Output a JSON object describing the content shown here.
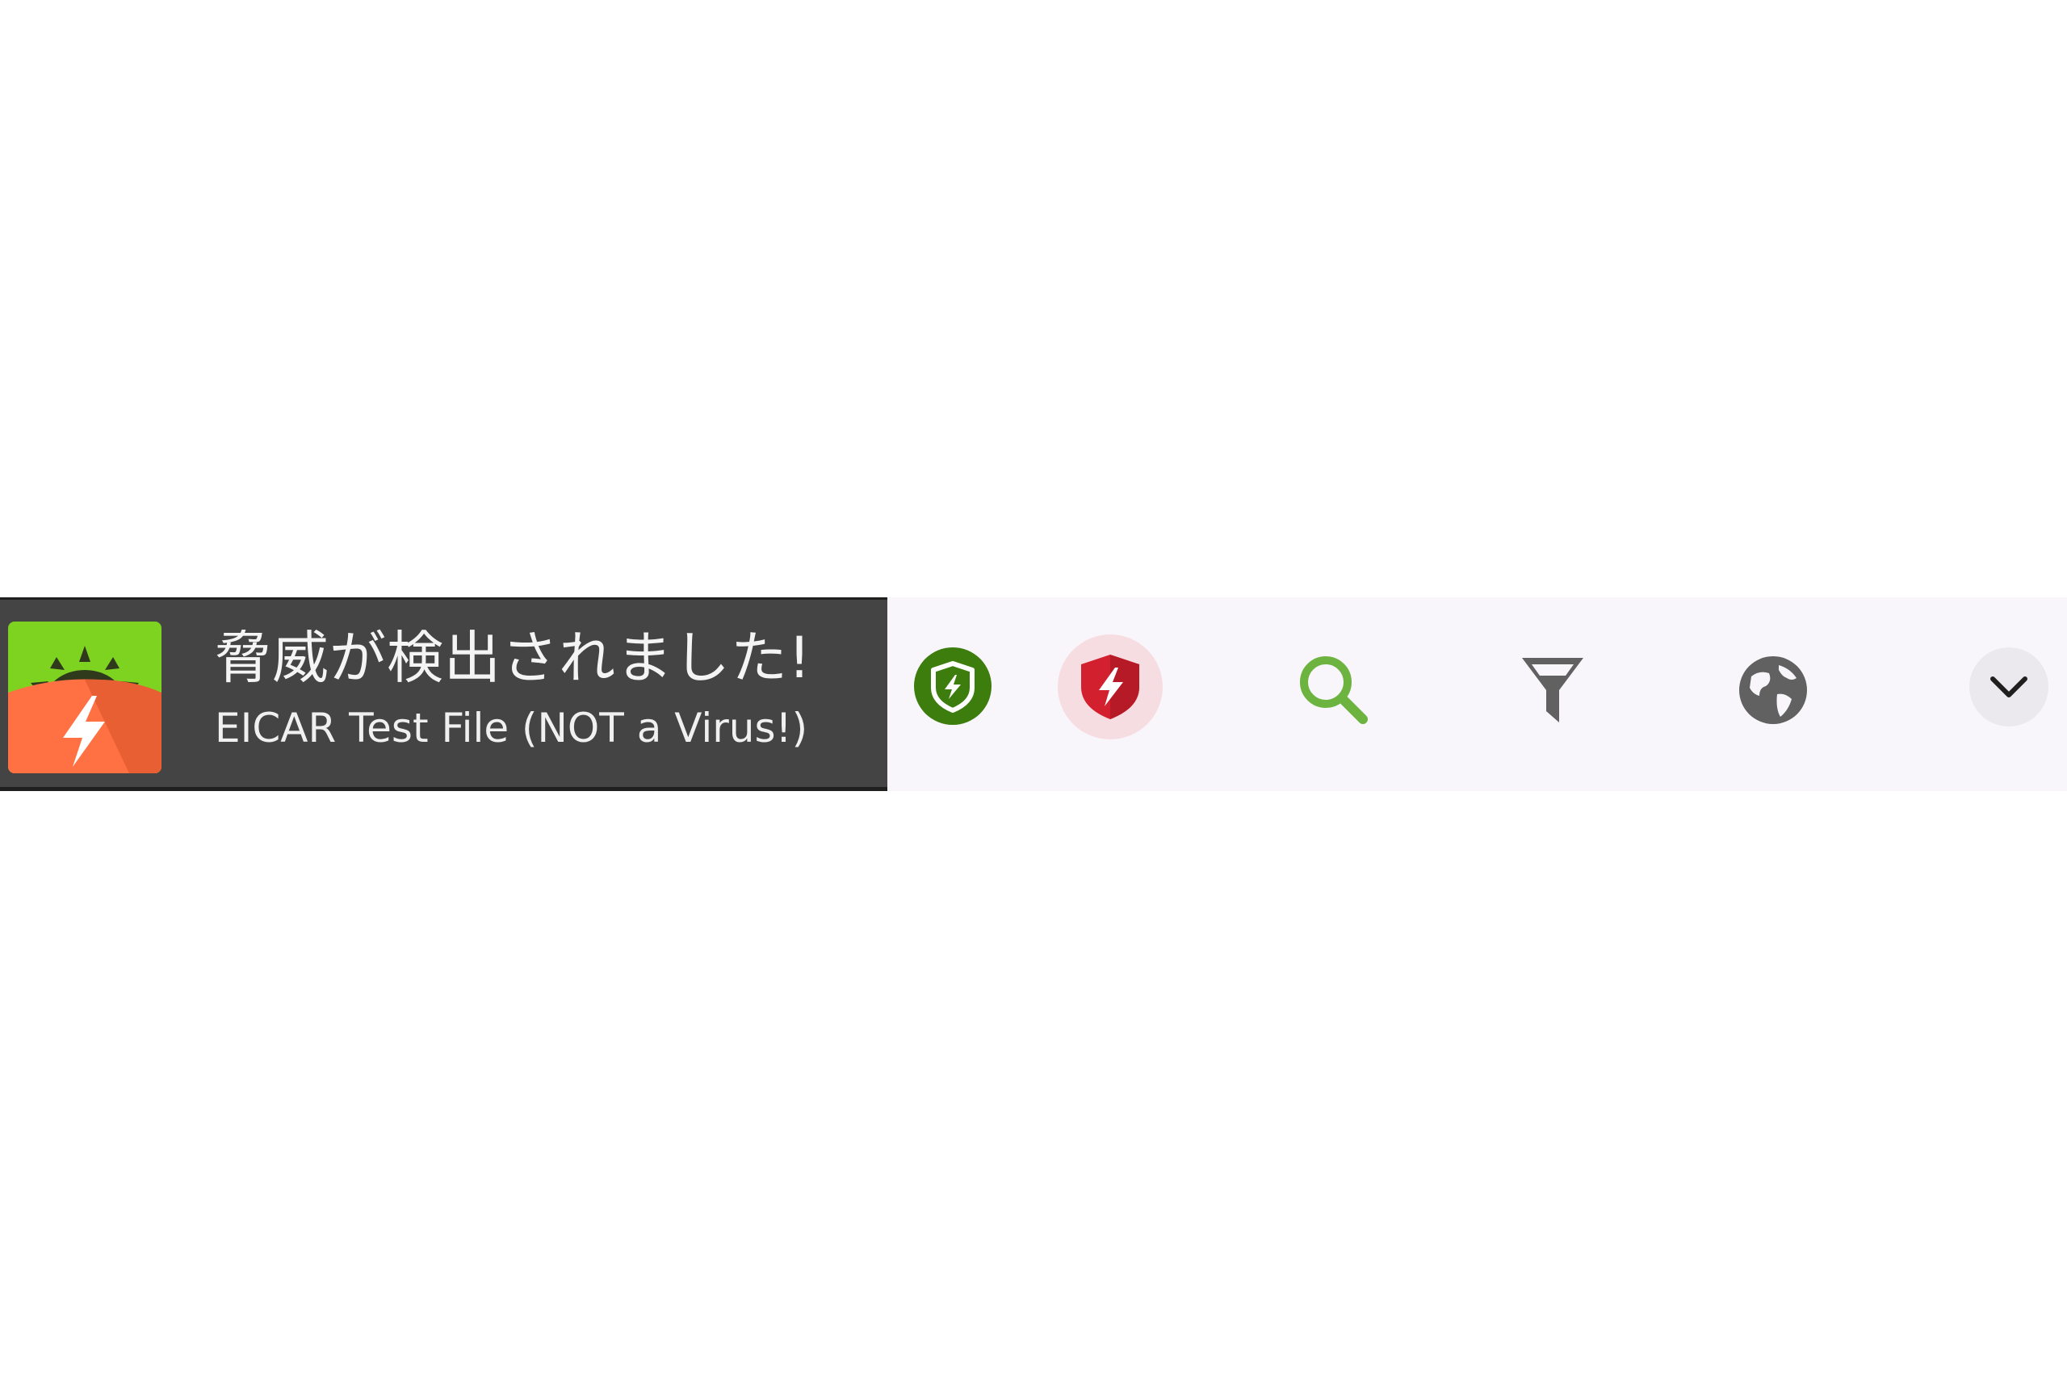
{
  "notification": {
    "icon": "alert-app-icon",
    "title": "脅威が検出されました!",
    "subtitle": "EICAR Test File (NOT a Virus!)"
  },
  "toolbar": {
    "items": [
      {
        "icon": "shield-bolt-icon",
        "color": "#3c7d0e"
      },
      {
        "icon": "shield-bolt-alert-icon",
        "color": "#d3202e",
        "highlight": "#f6dde2"
      },
      {
        "icon": "search-icon",
        "color": "#6db33f"
      },
      {
        "icon": "filter-icon",
        "color": "#616161"
      },
      {
        "icon": "globe-icon",
        "color": "#616161"
      },
      {
        "icon": "chevron-down-icon",
        "color": "#1f1f1f"
      }
    ]
  },
  "colors": {
    "notification_bg": "#444444",
    "toolbar_bg": "#f9f6fb",
    "icon_green": "#7ed321",
    "icon_orange": "#ff7043"
  }
}
